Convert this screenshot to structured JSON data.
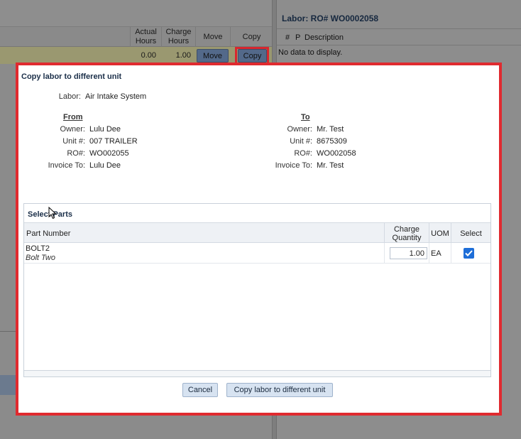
{
  "background": {
    "left_table": {
      "headers": [
        "Actual Hours",
        "Charge Hours",
        "Move",
        "Copy"
      ],
      "row": {
        "actual_hours": "0.00",
        "charge_hours": "1.00",
        "move_label": "Move",
        "copy_label": "Copy"
      }
    },
    "right_panel": {
      "title": "Labor: RO# WO0002058",
      "headers": [
        "#",
        "P",
        "Description"
      ],
      "empty_text": "No data to display."
    }
  },
  "modal": {
    "title": "Copy labor to different unit",
    "labor_label": "Labor:",
    "labor_value": "Air Intake System",
    "from": {
      "heading": "From",
      "owner_label": "Owner:",
      "owner": "Lulu Dee",
      "unit_label": "Unit #:",
      "unit": "007 TRAILER",
      "ro_label": "RO#:",
      "ro": "WO002055",
      "invoice_label": "Invoice To:",
      "invoice_to": "Lulu Dee"
    },
    "to": {
      "heading": "To",
      "owner_label": "Owner:",
      "owner": "Mr. Test",
      "unit_label": "Unit #:",
      "unit": "8675309",
      "ro_label": "RO#:",
      "ro": "WO002058",
      "invoice_label": "Invoice To:",
      "invoice_to": "Mr. Test"
    },
    "parts": {
      "title": "Select Parts",
      "columns": {
        "part_number": "Part Number",
        "charge_qty_line1": "Charge",
        "charge_qty_line2": "Quantity",
        "uom": "UOM",
        "select": "Select"
      },
      "rows": [
        {
          "part_number": "BOLT2",
          "description": "Bolt Two",
          "charge_quantity": "1.00",
          "uom": "EA",
          "selected": true
        }
      ]
    },
    "buttons": {
      "cancel": "Cancel",
      "copy": "Copy labor to different unit"
    }
  },
  "colors": {
    "highlight": "#e02a2f",
    "checkbox": "#1e6ed8",
    "title_text": "#1b2f49"
  }
}
